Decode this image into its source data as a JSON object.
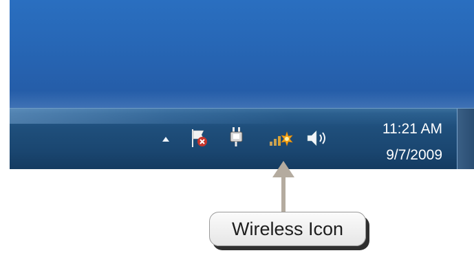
{
  "tray": {
    "icons": [
      "show-hidden-icons-arrow",
      "action-center-flag-icon",
      "power-plug-icon",
      "wireless-network-icon",
      "volume-speaker-icon"
    ],
    "clock": {
      "time": "11:21 AM",
      "date": "9/7/2009"
    }
  },
  "callout": {
    "label": "Wireless Icon"
  },
  "colors": {
    "desktop": "#2767b6",
    "taskbar": "#1a4670",
    "clock_text": "#ffffff",
    "pointer": "#b4ab9f",
    "callout_bg": "#efefef"
  }
}
